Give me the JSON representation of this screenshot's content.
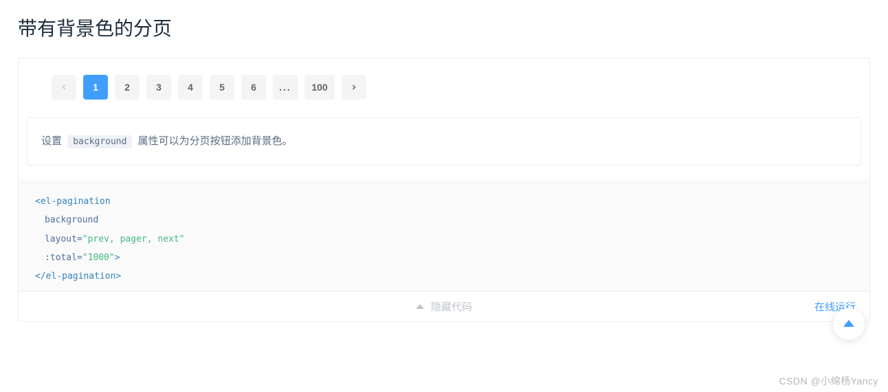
{
  "title": "带有背景色的分页",
  "pagination": {
    "prev_label": "‹",
    "next_label": "›",
    "pages": [
      {
        "label": "1",
        "active": true
      },
      {
        "label": "2",
        "active": false
      },
      {
        "label": "3",
        "active": false
      },
      {
        "label": "4",
        "active": false
      },
      {
        "label": "5",
        "active": false
      },
      {
        "label": "6",
        "active": false
      },
      {
        "label": "...",
        "ellipsis": true
      },
      {
        "label": "100",
        "active": false,
        "wide": true
      }
    ]
  },
  "description": {
    "before": "设置",
    "code": "background",
    "after": "属性可以为分页按钮添加背景色。"
  },
  "code": {
    "open_tag": "<el-pagination",
    "attr1": "background",
    "attr2_name": "layout=",
    "attr2_val": "\"prev, pager, next\"",
    "attr3_name": ":total=",
    "attr3_val": "\"1000\"",
    "attr3_close": ">",
    "close_tag": "</el-pagination>"
  },
  "footer": {
    "hide_code": "隐藏代码",
    "run_online": "在线运行"
  },
  "watermark": "CSDN @小绵杨Yancy"
}
